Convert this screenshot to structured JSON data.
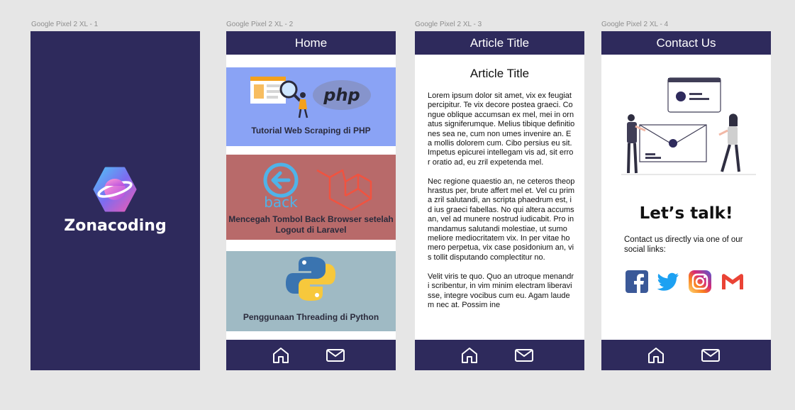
{
  "frames": [
    {
      "label": "Google Pixel 2 XL - 1"
    },
    {
      "label": "Google Pixel 2 XL - 2",
      "title": "Home"
    },
    {
      "label": "Google Pixel 2 XL - 3",
      "title": "Article Title"
    },
    {
      "label": "Google Pixel 2 XL - 4",
      "title": "Contact Us"
    }
  ],
  "splash": {
    "brand": "Zonacoding"
  },
  "home": {
    "cards": [
      {
        "title": "Tutorial Web Scraping di PHP",
        "bg": "#8aa3f5",
        "badge": "php"
      },
      {
        "title": "Mencegah Tombol Back Browser setelah Logout di Laravel",
        "bg": "#b86a6a",
        "badge": "back"
      },
      {
        "title": "Penggunaan Threading di Python",
        "bg": "#9fbac4"
      }
    ]
  },
  "article": {
    "heading": "Article Title",
    "paragraphs": [
      "Lorem ipsum dolor sit amet, vix ex feugiat percipitur. Te vix decore postea graeci. Congue oblique accumsan ex mel, mei in ornatus signiferumque. Melius tibique definitiones sea ne, cum non umes invenire an. Ea mollis dolorem cum. Cibo persius eu sit. Impetus epicurei intellegam vis ad, sit error oratio ad, eu zril expetenda mel.",
      "Nec regione quaestio an, ne ceteros theophrastus per, brute affert mel et. Vel cu prima zril salutandi, an scripta phaedrum est, id ius graeci fabellas. No qui altera accumsan, vel ad munere nostrud iudicabit. Pro in mandamus salutandi molestiae, ut sumo meliore mediocritatem vix. In per vitae homero perpetua, vix case posidonium an, vis tollit disputando complectitur no.",
      "Velit viris te quo. Quo an utroque menandri scribentur, in vim minim electram liberavisse, integre vocibus cum eu. Agam laudem nec at. Possim ine"
    ]
  },
  "contact": {
    "heading": "Let’s talk!",
    "text": "Contact us directly via one of our social links:",
    "socials": [
      "facebook-icon",
      "twitter-icon",
      "instagram-icon",
      "gmail-icon"
    ]
  },
  "nav": {
    "home_icon": "home-icon",
    "mail_icon": "mail-icon"
  },
  "colors": {
    "primary": "#2e2a5c",
    "canvas": "#e6e6e6"
  }
}
